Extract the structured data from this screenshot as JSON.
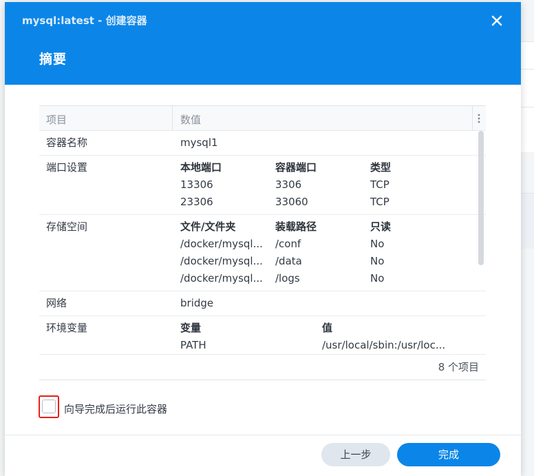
{
  "dialog": {
    "title": "mysql:latest - 创建容器",
    "heading": "摘要",
    "close_icon": "close-icon"
  },
  "table": {
    "headers": {
      "item": "项目",
      "value": "数值"
    },
    "rows": {
      "name": {
        "label": "容器名称",
        "value": "mysql1"
      },
      "ports": {
        "label": "端口设置",
        "headers": [
          "本地端口",
          "容器端口",
          "类型"
        ],
        "entries": [
          [
            "13306",
            "3306",
            "TCP"
          ],
          [
            "23306",
            "33060",
            "TCP"
          ]
        ]
      },
      "storage": {
        "label": "存储空间",
        "headers": [
          "文件/文件夹",
          "装载路径",
          "只读"
        ],
        "entries": [
          [
            "/docker/mysql...",
            "/conf",
            "No"
          ],
          [
            "/docker/mysql...",
            "/data",
            "No"
          ],
          [
            "/docker/mysql...",
            "/logs",
            "No"
          ]
        ]
      },
      "network": {
        "label": "网络",
        "value": "bridge"
      },
      "env": {
        "label": "环境变量",
        "headers": [
          "变量",
          "值"
        ],
        "entries": [
          [
            "PATH",
            "/usr/local/sbin:/usr/loc..."
          ]
        ]
      }
    },
    "item_count": "8 个项目"
  },
  "run_after_wizard": {
    "label": "向导完成后运行此容器",
    "checked": false
  },
  "buttons": {
    "back": "上一步",
    "finish": "完成"
  },
  "colors": {
    "header_blue": "#0b86e8",
    "highlight_red": "#e8201a"
  }
}
